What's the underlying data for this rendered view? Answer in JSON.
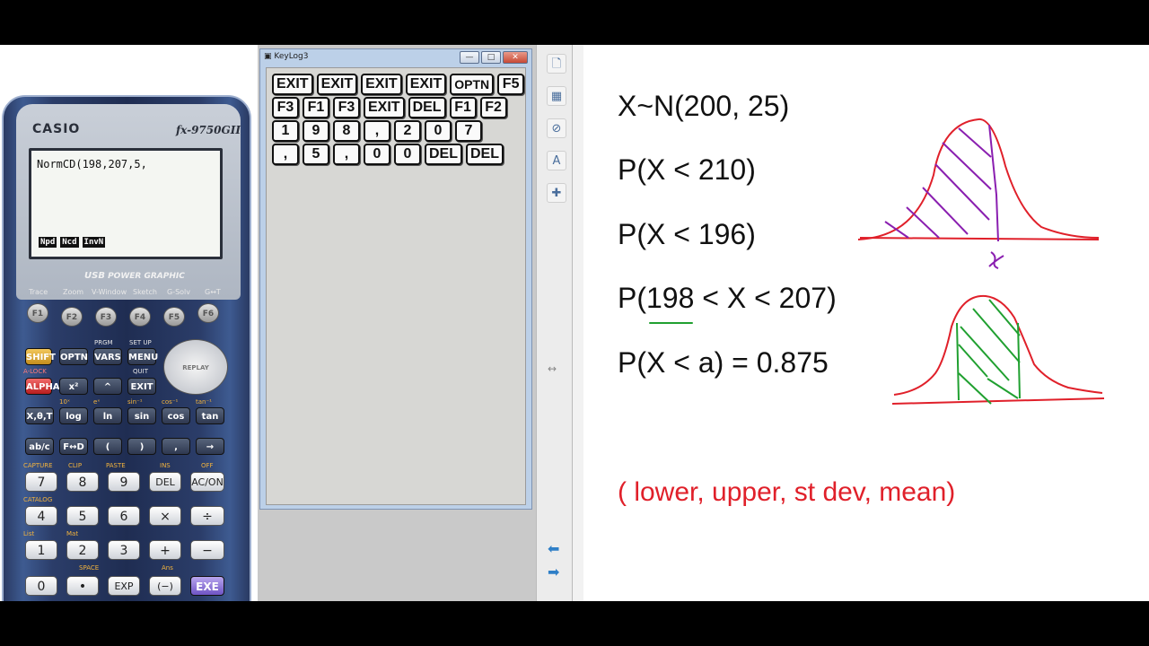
{
  "calculator": {
    "brand": "CASIO",
    "model": "fx-9750GII",
    "screen_text": "NormCD(198,207,5,",
    "soft_menu": [
      "Npd",
      "Ncd",
      "InvN"
    ],
    "banner_bold": "USB",
    "banner": " POWER GRAPHIC",
    "fn_labels": [
      "Trace",
      "Zoom",
      "V-Window",
      "Sketch",
      "G-Solv",
      "G↔T"
    ],
    "fkeys": [
      "F1",
      "F2",
      "F3",
      "F4",
      "F5",
      "F6"
    ],
    "keys": {
      "shift": "SHIFT",
      "optn": "OPTN",
      "vars": "VARS",
      "menu": "MENU",
      "alpha": "ALPHA",
      "x2": "x²",
      "up": "^",
      "exit": "EXIT",
      "xtheta": "X,θ,T",
      "log": "log",
      "ln": "ln",
      "sin": "sin",
      "cos": "cos",
      "tan": "tan",
      "abc": "ab/c",
      "fd": "F↔D",
      "lparen": "(",
      "rparen": ")",
      "comma": ",",
      "arrow": "→",
      "n7": "7",
      "n8": "8",
      "n9": "9",
      "del": "DEL",
      "ac": "AC/ON",
      "n4": "4",
      "n5": "5",
      "n6": "6",
      "times": "×",
      "div": "÷",
      "n1": "1",
      "n2": "2",
      "n3": "3",
      "plus": "+",
      "minus": "−",
      "n0": "0",
      "dot": "•",
      "exp": "EXP",
      "neg": "(−)",
      "exe": "EXE",
      "replay": "REPLAY"
    },
    "labels": {
      "prgm": "PRGM",
      "setup": "SET UP",
      "quit": "QUIT",
      "alock": "A-LOCK",
      "ten_x": "10ˣ",
      "ex": "eˣ",
      "sin_inv": "sin⁻¹",
      "cos_inv": "cos⁻¹",
      "tan_inv": "tan⁻¹",
      "capture": "CAPTURE",
      "clip": "CLIP",
      "paste": "PASTE",
      "ins": "INS",
      "off": "OFF",
      "catalog": "CATALOG",
      "list": "List",
      "mat": "Mat",
      "space": "SPACE",
      "ans": "Ans"
    }
  },
  "keylog": {
    "title": "KeyLog3",
    "rows": [
      [
        "EXIT",
        "EXIT",
        "EXIT",
        "EXIT",
        "OPTN",
        "F5"
      ],
      [
        "F3",
        "F1",
        "F3",
        "EXIT",
        "DEL",
        "F1",
        "F2"
      ],
      [
        "1",
        "9",
        "8",
        ",",
        "2",
        "0",
        "7"
      ],
      [
        ",",
        "5",
        ",",
        "0",
        "0",
        "DEL",
        "DEL"
      ]
    ]
  },
  "board": {
    "lines": [
      "X~N(200, 25)",
      "P(X < 210)",
      "P(X < 196)",
      "P(198 < X < 207)",
      "P(X < a) = 0.875"
    ],
    "note": "( lower, upper, st dev, mean)",
    "sketch_label": "x",
    "colors": {
      "curve": "#e0202a",
      "hatch1": "#8a1fb0",
      "hatch2": "#20a030",
      "note": "#e0202a"
    }
  }
}
